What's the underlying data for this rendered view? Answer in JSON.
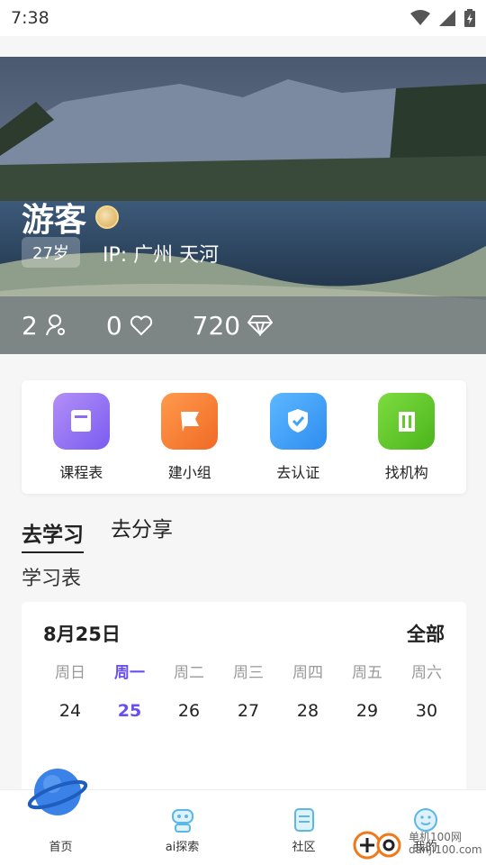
{
  "status": {
    "time": "7:38"
  },
  "profile": {
    "name": "游客",
    "age": "27岁",
    "ip": "IP: 广州 天河",
    "stats": [
      {
        "value": "2",
        "icon": "user-icon"
      },
      {
        "value": "0",
        "icon": "heart-icon"
      },
      {
        "value": "720",
        "icon": "diamond-icon"
      }
    ]
  },
  "quick_actions": [
    {
      "label": "课程表",
      "icon": "book-icon",
      "color": "#8b6cf2"
    },
    {
      "label": "建小组",
      "icon": "flag-icon",
      "color": "#f5803a"
    },
    {
      "label": "去认证",
      "icon": "shield-check-icon",
      "color": "#3ea4f7"
    },
    {
      "label": "找机构",
      "icon": "building-icon",
      "color": "#62c92c"
    }
  ],
  "tabs": {
    "study": "去学习",
    "share": "去分享"
  },
  "section_title": "学习表",
  "calendar": {
    "date_label": "8月25日",
    "all_label": "全部",
    "weekdays": [
      "周日",
      "周一",
      "周二",
      "周三",
      "周四",
      "周五",
      "周六"
    ],
    "dates": [
      "24",
      "25",
      "26",
      "27",
      "28",
      "29",
      "30"
    ],
    "current_index": 1,
    "accent": "#6a4ff0"
  },
  "tabbar": {
    "home": "首页",
    "ai": "ai探索",
    "community": "社区",
    "mine": "我的"
  },
  "watermark": {
    "line1": "单机100网",
    "line2": "danji100.com"
  }
}
